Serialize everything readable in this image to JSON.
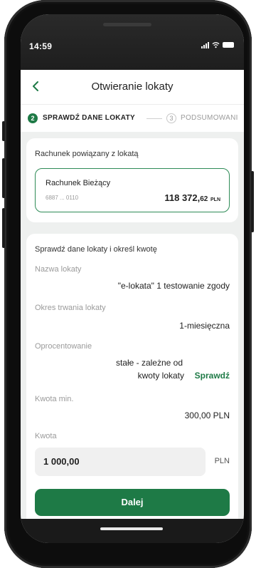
{
  "status_bar": {
    "time": "14:59"
  },
  "header": {
    "title": "Otwieranie lokaty"
  },
  "steps": [
    {
      "number": "2",
      "label": "SPRAWDŹ DANE LOKATY",
      "active": true
    },
    {
      "number": "3",
      "label": "PODSUMOWANI",
      "active": false
    }
  ],
  "linked_account": {
    "title": "Rachunek powiązany z lokatą",
    "name": "Rachunek Bieżący",
    "number": "6887 ... 0110",
    "balance_int": "118 372,",
    "balance_dec": "62",
    "currency": "PLN"
  },
  "deposit": {
    "heading": "Sprawdź dane lokaty i określ kwotę",
    "name_label": "Nazwa lokaty",
    "name_value": "\"e-lokata\"  1 testowanie zgody",
    "period_label": "Okres trwania lokaty",
    "period_value": "1-miesięczna",
    "rate_label": "Oprocentowanie",
    "rate_line1": "stałe - zależne od",
    "rate_line2": "kwoty lokaty",
    "rate_link": "Sprawdź",
    "min_label": "Kwota min.",
    "min_value": "300,00 PLN",
    "amount_label": "Kwota",
    "amount_value": "1 000,00",
    "amount_currency": "PLN"
  },
  "actions": {
    "next_label": "Dalej"
  },
  "colors": {
    "brand_green": "#1e7a46",
    "border_green": "#2e8b57"
  }
}
